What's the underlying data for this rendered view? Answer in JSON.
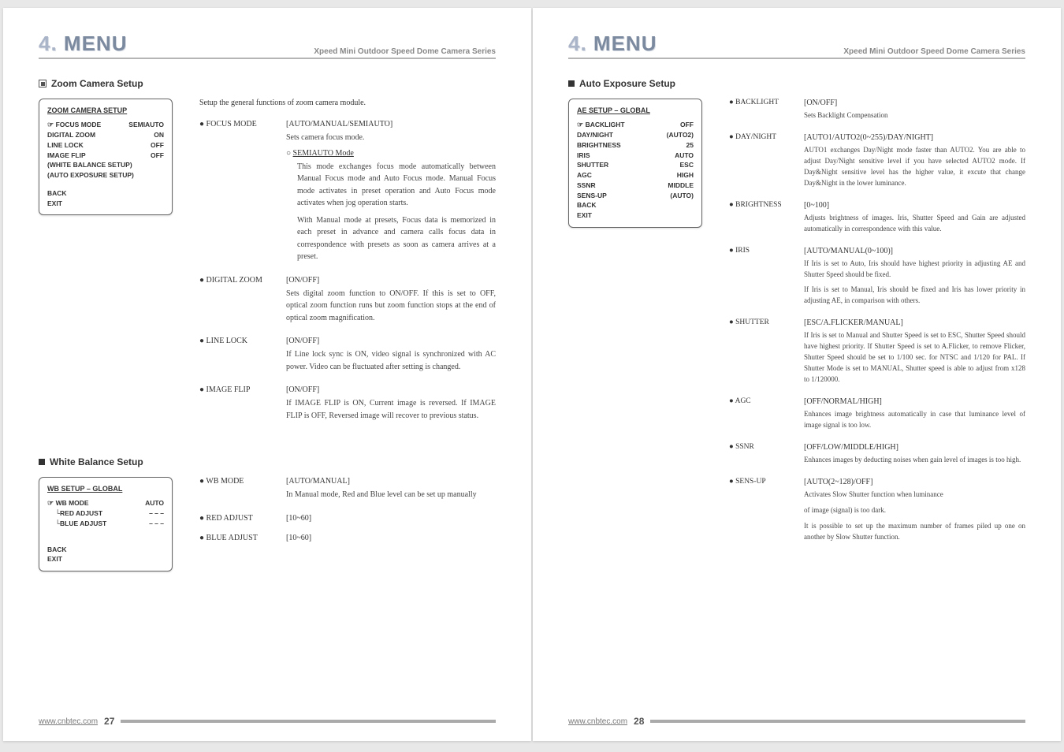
{
  "header": {
    "menu_num": "4.",
    "menu_word": "MENU",
    "series": "Xpeed Mini Outdoor Speed Dome Camera Series"
  },
  "footer": {
    "url": "www.cnbtec.com",
    "page_left": "27",
    "page_right": "28"
  },
  "left": {
    "zoom_section": "Zoom Camera Setup",
    "intro": "Setup the general functions of zoom camera module.",
    "zoom_box": {
      "title": "ZOOM CAMERA SETUP",
      "lines": [
        {
          "k": "FOCUS MODE",
          "v": "SEMIAUTO",
          "ptr": true
        },
        {
          "k": "DIGITAL ZOOM",
          "v": "ON"
        },
        {
          "k": "LINE LOCK",
          "v": "OFF"
        },
        {
          "k": "IMAGE FLIP",
          "v": "OFF"
        },
        {
          "k": "(WHITE BALANCE SETUP)",
          "v": ""
        },
        {
          "k": "(AUTO EXPOSURE SETUP)",
          "v": ""
        }
      ],
      "back": "BACK",
      "exit": "EXIT"
    },
    "focus": {
      "label": "● FOCUS MODE",
      "bracket": "[AUTO/MANUAL/SEMIAUTO]",
      "line1": "Sets camera focus mode.",
      "sub": "○ SEMIAUTO Mode",
      "p1": "This mode exchanges focus mode automatically between Manual Focus mode and Auto Focus mode. Manual Focus mode activates in preset operation and Auto Focus mode activates when jog operation starts.",
      "p2": "With Manual mode at presets, Focus data is memorized in each preset in advance and camera calls focus data in correspondence with presets as soon as camera arrives at a preset."
    },
    "digital": {
      "label": "● DIGITAL ZOOM",
      "bracket": "[ON/OFF]",
      "body": "Sets digital zoom function to ON/OFF. If this is set to OFF, optical zoom function runs but zoom function stops at the end of optical zoom magnification."
    },
    "linelock": {
      "label": "● LINE LOCK",
      "bracket": "[ON/OFF]",
      "body": "If Line lock sync is ON, video signal is synchronized with AC power. Video can be fluctuated after setting is changed."
    },
    "imageflip": {
      "label": "● IMAGE FLIP",
      "bracket": "[ON/OFF]",
      "body": "If IMAGE FLIP is ON, Current image is reversed. If IMAGE FLIP is OFF, Reversed image will recover to previous status."
    },
    "wb_section": "White Balance Setup",
    "wb_box": {
      "title": "WB SETUP – GLOBAL",
      "lines": [
        {
          "k": "WB MODE",
          "v": "AUTO",
          "ptr": true
        },
        {
          "k": "RED ADJUST",
          "v": "– – –",
          "tree": true
        },
        {
          "k": "BLUE ADJUST",
          "v": "– – –",
          "tree": true
        }
      ],
      "back": "BACK",
      "exit": "EXIT"
    },
    "wb_mode": {
      "label": "● WB MODE",
      "bracket": "[AUTO/MANUAL]",
      "body": "In Manual mode, Red and Blue level can be set up manually"
    },
    "red": {
      "label": "● RED ADJUST",
      "bracket": "[10~60]"
    },
    "blue": {
      "label": "● BLUE ADJUST",
      "bracket": "[10~60]"
    }
  },
  "right": {
    "ae_section": "Auto Exposure Setup",
    "ae_box": {
      "title": "AE SETUP – GLOBAL",
      "lines": [
        {
          "k": "BACKLIGHT",
          "v": "OFF",
          "ptr": true
        },
        {
          "k": "DAY/NIGHT",
          "v": "(AUTO2)"
        },
        {
          "k": "BRIGHTNESS",
          "v": "25"
        },
        {
          "k": "IRIS",
          "v": "AUTO"
        },
        {
          "k": "SHUTTER",
          "v": "ESC"
        },
        {
          "k": "AGC",
          "v": "HIGH"
        },
        {
          "k": "SSNR",
          "v": "MIDDLE"
        },
        {
          "k": "SENS-UP",
          "v": "(AUTO)"
        }
      ],
      "back": "BACK",
      "exit": "EXIT"
    },
    "items": [
      {
        "label": "● BACKLIGHT",
        "bracket": "[ON/OFF]",
        "body": "Sets Backlight Compensation"
      },
      {
        "label": "● DAY/NIGHT",
        "bracket": "[AUTO1/AUTO2(0~255)/DAY/NIGHT]",
        "body": "AUTO1 exchanges Day/Night mode faster than AUTO2. You are able to adjust Day/Night sensitive level if you have selected AUTO2 mode. If Day&Night sensitive level has the higher value, it excute that change Day&Night in the lower luminance."
      },
      {
        "label": "● BRIGHTNESS",
        "bracket": "[0~100]",
        "body": "Adjusts brightness of images. Iris, Shutter Speed and Gain are adjusted automatically in correspondence with this value."
      },
      {
        "label": "● IRIS",
        "bracket": "[AUTO/MANUAL(0~100)]",
        "body": "If Iris is set to Auto, Iris should have highest priority in adjusting AE and Shutter Speed should be fixed.",
        "body2": "If Iris is set to Manual, Iris should be fixed and Iris has lower priority in adjusting AE, in comparison with others."
      },
      {
        "label": "● SHUTTER",
        "bracket": "[ESC/A.FLICKER/MANUAL]",
        "body": "If Iris is set to Manual and Shutter Speed is set to ESC, Shutter Speed should have highest priority. If Shutter Speed is set to A.Flicker, to remove Flicker, Shutter Speed should be set to 1/100 sec. for NTSC and 1/120 for PAL. If Shutter Mode is set to MANUAL, Shutter speed is able to adjust from x128 to 1/120000."
      },
      {
        "label": "● AGC",
        "bracket": "[OFF/NORMAL/HIGH]",
        "body": "Enhances image brightness automatically in case that luminance level of image signal is too low."
      },
      {
        "label": "● SSNR",
        "bracket": "[OFF/LOW/MIDDLE/HIGH]",
        "body": "Enhances images by deducting noises when gain level of images is too high."
      },
      {
        "label": "● SENS-UP",
        "bracket": "[AUTO(2~128)/OFF]",
        "body": "Activates Slow Shutter function when luminance",
        "body2": "of image (signal) is too dark.",
        "body3": "It is possible to set up the maximum number of frames piled up one on another by Slow Shutter function."
      }
    ]
  }
}
